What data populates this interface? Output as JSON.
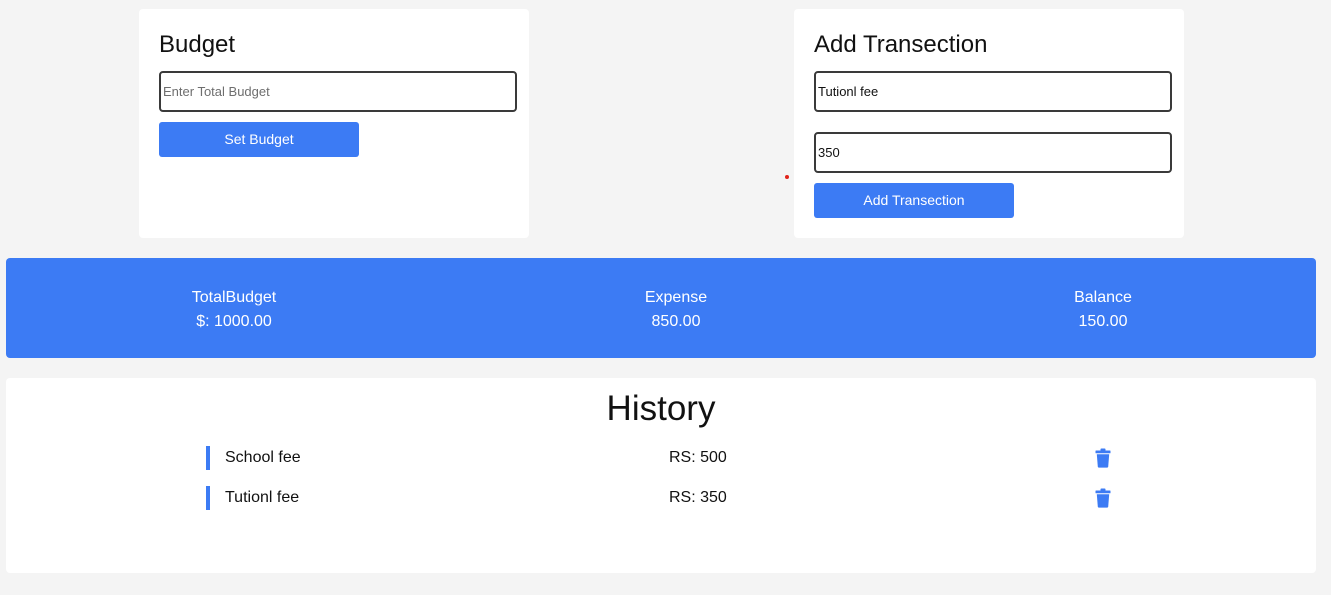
{
  "budget_card": {
    "title": "Budget",
    "input_placeholder": "Enter Total Budget",
    "input_value": "",
    "button_label": "Set Budget"
  },
  "transaction_card": {
    "title": "Add Transection",
    "name_value": "Tutionl fee",
    "amount_value": "350",
    "button_label": "Add Transection"
  },
  "summary": {
    "total_label": "TotalBudget",
    "total_value": "$: 1000.00",
    "expense_label": "Expense",
    "expense_value": "850.00",
    "balance_label": "Balance",
    "balance_value": "150.00"
  },
  "history": {
    "title": "History",
    "items": [
      {
        "name": "School fee",
        "amount": "RS: 500",
        "icon": "trash-icon"
      },
      {
        "name": "Tutionl fee",
        "amount": "RS: 350",
        "icon": "trash-icon"
      }
    ]
  },
  "colors": {
    "accent": "#3c7bf4",
    "background": "#f4f4f4",
    "card": "#ffffff",
    "dot": "#e0241b"
  }
}
